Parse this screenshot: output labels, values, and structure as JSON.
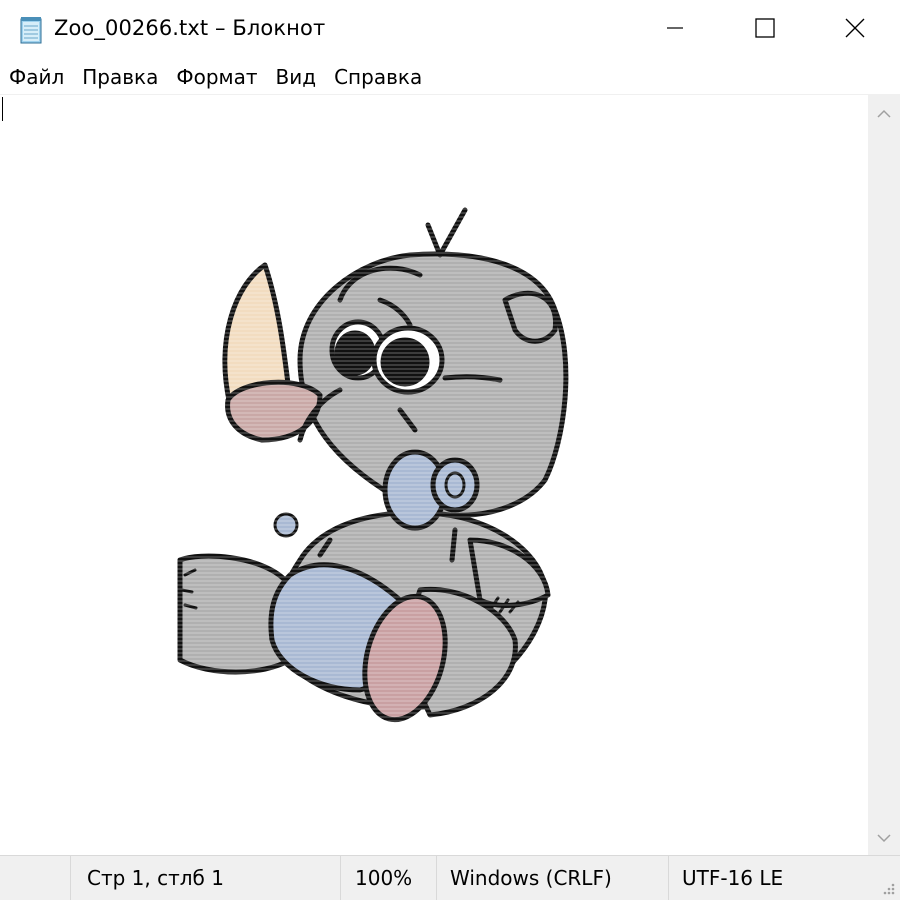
{
  "window": {
    "title": "Zoo_00266.txt – Блокнот",
    "icon": "notepad-icon",
    "controls": {
      "minimize_icon": "minimize-icon",
      "maximize_icon": "maximize-icon",
      "close_icon": "close-icon"
    }
  },
  "menu": {
    "items": [
      {
        "label": "Файл"
      },
      {
        "label": "Правка"
      },
      {
        "label": "Формат"
      },
      {
        "label": "Вид"
      },
      {
        "label": "Справка"
      }
    ]
  },
  "editor": {
    "content_description_icon": "ascii-art-rhino",
    "colors": {
      "body_gray": "#b0b0b0",
      "outline": "#111111",
      "horn": "#f2dcc0",
      "nose_ring": "#c9a8a6",
      "overalls_blue": "#a9b9d3",
      "foot_pad": "#c9a0a2",
      "eye_white": "#ffffff"
    }
  },
  "status": {
    "position": "Стр 1, стлб 1",
    "zoom": "100%",
    "line_endings": "Windows (CRLF)",
    "encoding": "UTF-16 LE"
  }
}
